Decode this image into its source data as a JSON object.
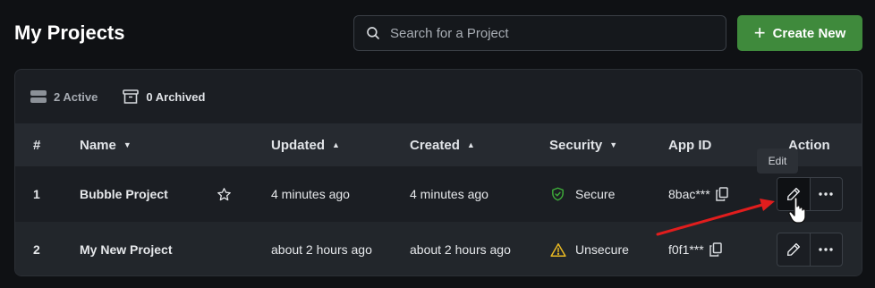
{
  "header": {
    "title": "My Projects",
    "search_placeholder": "Search for a Project",
    "create_label": "Create New"
  },
  "filters": {
    "active": "2 Active",
    "archived": "0 Archived"
  },
  "table": {
    "columns": {
      "num": "#",
      "name": "Name",
      "updated": "Updated",
      "created": "Created",
      "security": "Security",
      "app_id": "App ID",
      "action": "Action"
    },
    "rows": [
      {
        "num": "1",
        "name": "Bubble Project",
        "updated": "4 minutes ago",
        "created": "4 minutes ago",
        "security": "Secure",
        "app_id": "8bac***"
      },
      {
        "num": "2",
        "name": "My New Project",
        "updated": "about 2 hours ago",
        "created": "about 2 hours ago",
        "security": "Unsecure",
        "app_id": "f0f1***"
      }
    ]
  },
  "tooltip": "Edit",
  "colors": {
    "primary": "#3f8a3c",
    "secure": "#3fae3a",
    "warning": "#e8b823",
    "annotation": "#e11d1d"
  }
}
